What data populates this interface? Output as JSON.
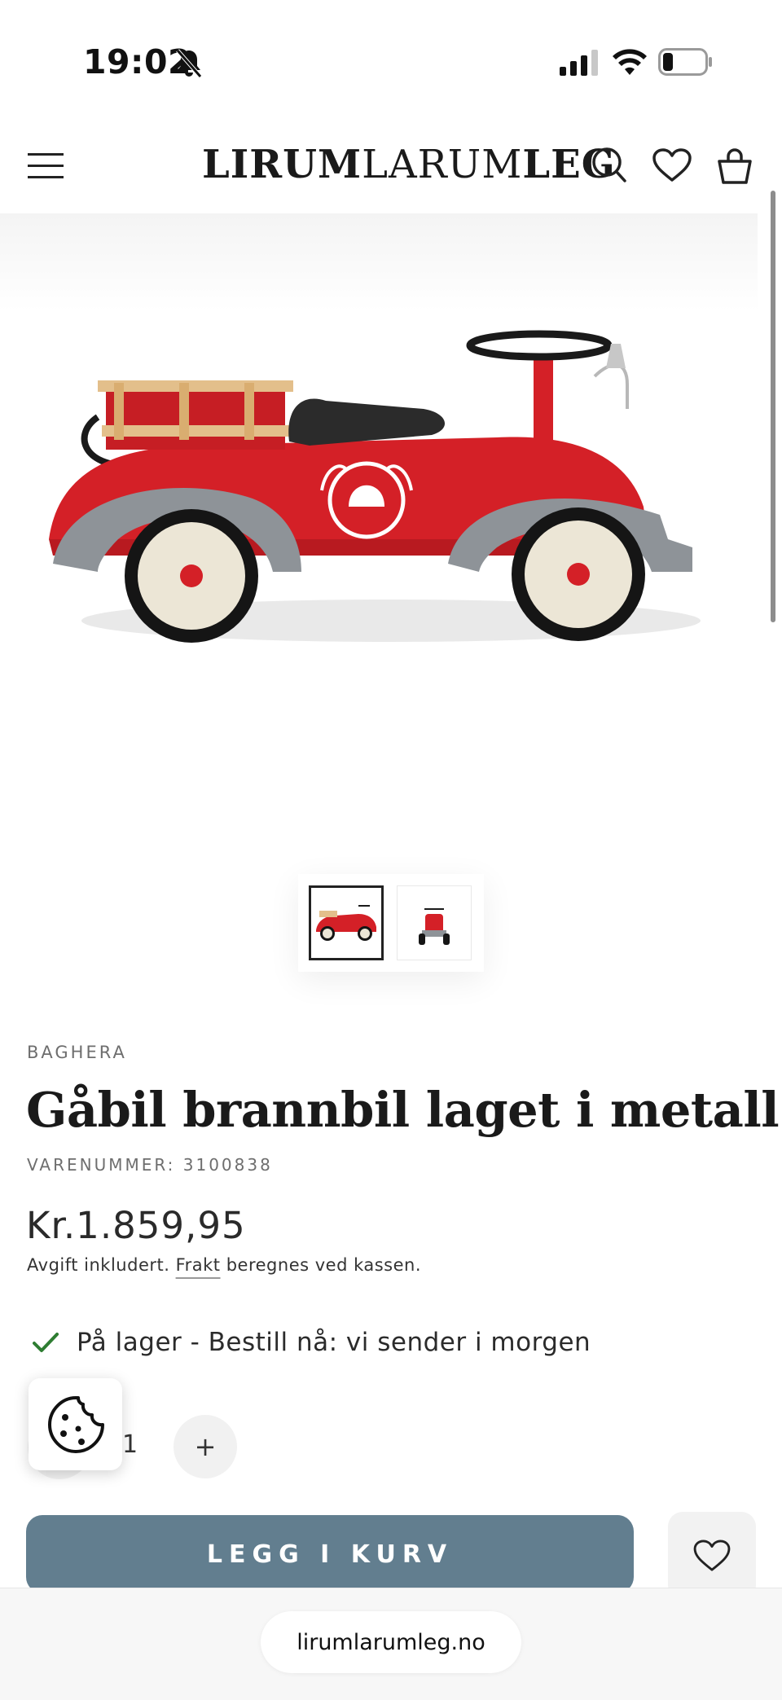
{
  "status_bar": {
    "time": "19:02",
    "icons": [
      "bell-slash-icon",
      "cellular-signal-icon",
      "wifi-icon",
      "battery-icon"
    ]
  },
  "header": {
    "logo_bold": "LIRUM",
    "logo_regular": "LARUM",
    "logo_bold_end": "LEG",
    "icons": [
      "menu-icon",
      "search-icon",
      "heart-icon",
      "shopping-bag-icon"
    ]
  },
  "gallery": {
    "thumbnails": [
      "side view",
      "front view"
    ],
    "selected_index": 0
  },
  "product": {
    "vendor": "BAGHERA",
    "title": "Gåbil brannbil laget i metall",
    "sku": "VARENUMMER: 3100838",
    "price": "Kr.1.859,95",
    "tax_prefix": "Avgift inkludert. ",
    "tax_link": "Frakt",
    "tax_suffix": " beregnes ved kassen.",
    "stock": "På lager - Bestill nå: vi sender i morgen",
    "quantity": "1",
    "plus_symbol": "+"
  },
  "actions": {
    "add_to_cart": "LEGG I KURV"
  },
  "browser": {
    "url": "lirumlarumleg.no"
  },
  "colors": {
    "accent_button": "#627e8f",
    "stock_check": "#2e7d32",
    "car_red": "#d42027"
  }
}
